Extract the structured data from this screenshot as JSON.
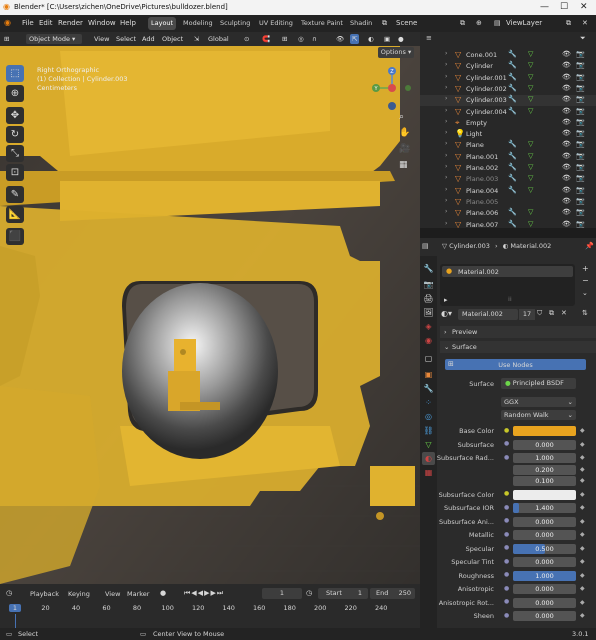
{
  "window": {
    "title": "Blender* [C:\\Users\\zichen\\OneDrive\\Pictures\\bulldozer.blend]"
  },
  "menus": [
    "File",
    "Edit",
    "Render",
    "Window",
    "Help"
  ],
  "workspace_tabs": [
    "Layout",
    "Modeling",
    "Sculpting",
    "UV Editing",
    "Texture Paint",
    "Shadin"
  ],
  "scene_label": "Scene",
  "viewlayer_label": "ViewLayer",
  "viewport_header": {
    "mode": "Object Mode",
    "view": "View",
    "select": "Select",
    "add": "Add",
    "object": "Object",
    "orientation": "Global",
    "options": "Options"
  },
  "viewport_overlay": {
    "view_name": "Right Orthographic",
    "collection": "(1) Collection | Cylinder.003",
    "units": "Centimeters"
  },
  "gizmo": {
    "z": "Z",
    "y": "Y"
  },
  "outliner": {
    "items": [
      {
        "name": "Cone.001",
        "dim": false
      },
      {
        "name": "Cylinder",
        "dim": false
      },
      {
        "name": "Cylinder.001",
        "dim": false
      },
      {
        "name": "Cylinder.002",
        "dim": false
      },
      {
        "name": "Cylinder.003",
        "dim": false
      },
      {
        "name": "Cylinder.004",
        "dim": false
      },
      {
        "name": "Empty",
        "dim": false
      },
      {
        "name": "Light",
        "dim": false
      },
      {
        "name": "Plane",
        "dim": false
      },
      {
        "name": "Plane.001",
        "dim": false
      },
      {
        "name": "Plane.002",
        "dim": false
      },
      {
        "name": "Plane.003",
        "dim": true
      },
      {
        "name": "Plane.004",
        "dim": false
      },
      {
        "name": "Plane.005",
        "dim": true
      },
      {
        "name": "Plane.006",
        "dim": false
      },
      {
        "name": "Plane.007",
        "dim": false
      }
    ]
  },
  "properties": {
    "breadcrumb_object": "Cylinder.003",
    "breadcrumb_material": "Material.002",
    "slot_name": "Material.002",
    "material_name": "Material.002",
    "user_count": "17",
    "panel_preview": "Preview",
    "panel_surface": "Surface",
    "use_nodes": "Use Nodes",
    "surface_label": "Surface",
    "surface_value": "Principled BSDF",
    "distribution": "GGX",
    "sss_method": "Random Walk",
    "rows": [
      {
        "label": "Base Color",
        "value": "",
        "type": "color-orange"
      },
      {
        "label": "Subsurface",
        "value": "0.000",
        "type": "num"
      },
      {
        "label": "Subsurface Rad...",
        "value": "1.000",
        "type": "num"
      },
      {
        "label": "",
        "value": "0.200",
        "type": "num"
      },
      {
        "label": "",
        "value": "0.100",
        "type": "num"
      },
      {
        "label": "Subsurface Color",
        "value": "",
        "type": "color-white"
      },
      {
        "label": "Subsurface IOR",
        "value": "1.400",
        "type": "num"
      },
      {
        "label": "Subsurface Ani...",
        "value": "0.000",
        "type": "num"
      },
      {
        "label": "Metallic",
        "value": "0.000",
        "type": "num"
      },
      {
        "label": "Specular",
        "value": "0.500",
        "type": "num"
      },
      {
        "label": "Specular Tint",
        "value": "0.000",
        "type": "num"
      },
      {
        "label": "Roughness",
        "value": "1.000",
        "type": "num"
      },
      {
        "label": "Anisotropic",
        "value": "0.000",
        "type": "num"
      },
      {
        "label": "Anisotropic Rot...",
        "value": "0.000",
        "type": "num"
      },
      {
        "label": "Sheen",
        "value": "0.000",
        "type": "num"
      }
    ],
    "fill_levels": {
      "Subsurface IOR": 0.1,
      "Specular": 0.5,
      "Roughness": 1.0
    }
  },
  "timeline": {
    "playback": "Playback",
    "keying": "Keying",
    "view": "View",
    "marker": "Marker",
    "current_frame": "1",
    "start_label": "Start",
    "start": "1",
    "end_label": "End",
    "end": "250",
    "ticks": [
      "1",
      "20",
      "40",
      "60",
      "80",
      "100",
      "120",
      "140",
      "160",
      "180",
      "200",
      "220",
      "240"
    ]
  },
  "statusbar": {
    "select": "Select",
    "center": "Center View to Mouse",
    "version": "3.0.1"
  },
  "colors": {
    "accent": "#4772b3",
    "base_color": "#e8a31f",
    "object_yellow": "#e2b12d"
  }
}
